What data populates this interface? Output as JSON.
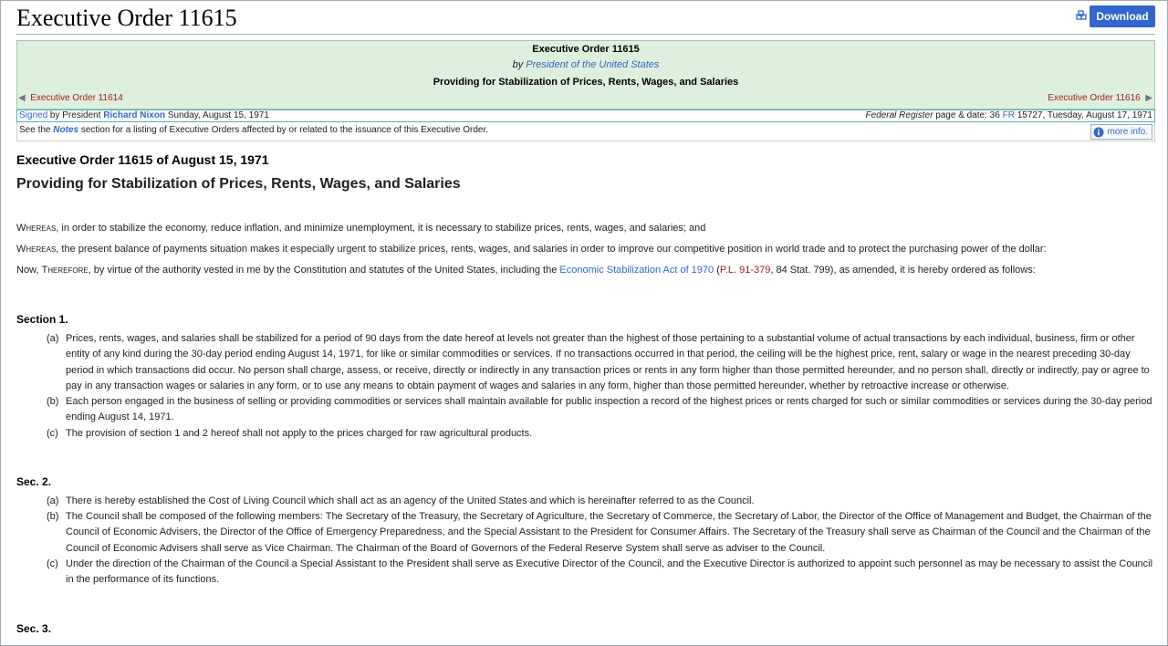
{
  "page": {
    "title": "Executive Order 11615",
    "download_label": "Download"
  },
  "header": {
    "title": "Executive Order 11615",
    "author_prefix": "by",
    "author": "President of the United States",
    "subtitle": "Providing for Stabilization of Prices, Rents, Wages, and Salaries",
    "prev": "Executive Order 11614",
    "next": "Executive Order 11616"
  },
  "signature": {
    "signed_link": "Signed",
    "by_text": "by President",
    "president": "Richard Nixon",
    "date": "Sunday, August 15, 1971",
    "fr_label": "Federal Register",
    "fr_text": "page & date: 36",
    "fr_abbr": "FR",
    "fr_rest": "15727, Tuesday, August 17, 1971"
  },
  "notes": {
    "prefix": "See the",
    "notes_link": "Notes",
    "suffix": "section for a listing of Executive Orders affected by or related to the issuance of this Executive Order.",
    "more_label": "more info."
  },
  "document": {
    "heading": "Executive Order 11615 of August 15, 1971",
    "subheading": "Providing for Stabilization of Prices, Rents, Wages, and Salaries",
    "whereas_word": "Whereas",
    "whereas1": ", in order to stabilize the economy, reduce inflation, and minimize unemployment, it is necessary to stabilize prices, rents, wages, and salaries; and",
    "whereas2": ", the present balance of payments situation makes it especially urgent to stabilize prices, rents, wages, and salaries in order to improve our competitive position in world trade and to protect the purchasing power of the dollar:",
    "now_a": "Now, ",
    "therefore_word": "Therefore",
    "now_b": ", by virtue of the authority vested in me by the Constitution and statutes of the United States, including the ",
    "act_link": "Economic Stabilization Act of 1970",
    "paren_open": " (",
    "pl_link": "P.L. 91-379",
    "now_c": ", 84 Stat. 799), as amended, it is hereby ordered as follows:",
    "sections": [
      {
        "label": "Section  1.",
        "items": [
          {
            "marker": "(a)",
            "text": "Prices, rents, wages, and salaries shall be stabilized for a period of 90 days from the date hereof at levels not greater than the highest of those pertaining to a substantial volume of actual transactions by each individual, business, firm or other entity of any kind during the 30-day period ending August 14, 1971, for like or similar commodities or services. If no transactions occurred in that period, the ceiling will be the highest price, rent, salary or wage in the nearest preceding 30-day period in which transactions did occur. No person shall charge, assess, or receive, directly or indirectly in any transaction prices or rents in any form higher than those permitted hereunder, and no person shall, directly or indirectly, pay or agree to pay in any transaction wages or salaries in any form, or to use any means to obtain payment of wages and salaries in any form, higher than those permitted hereunder, whether by retroactive increase or otherwise."
          },
          {
            "marker": "(b)",
            "text": "Each person engaged in the business of selling or providing commodities or services shall maintain available for public inspection a record of the highest prices or rents charged for such or similar commodities or services during the 30-day period ending August 14, 1971."
          },
          {
            "marker": "(c)",
            "text": "The provision of section 1 and 2 hereof shall not apply to the prices charged for raw agricultural products."
          }
        ]
      },
      {
        "label": "Sec.  2.",
        "items": [
          {
            "marker": "(a)",
            "text": "There is hereby established the Cost of Living Council which shall act as an agency of the United States and which is hereinafter referred to as the Council."
          },
          {
            "marker": "(b)",
            "text": "The Council shall be composed of the following members: The Secretary of the Treasury, the Secretary of Agriculture, the Secretary of Commerce, the Secretary of Labor, the Director of the Office of Management and Budget, the Chairman of the Council of Economic Advisers, the Director of the Office of Emergency Preparedness, and the Special Assistant to the President for Consumer Affairs. The Secretary of the Treasury shall serve as Chairman of the Council and the Chairman of the Council of Economic Advisers shall serve as Vice Chairman. The Chairman of the Board of Governors of the Federal Reserve System shall serve as adviser to the Council."
          },
          {
            "marker": "(c)",
            "text": "Under the direction of the Chairman of the Council a Special Assistant to the President shall serve as Executive Director of the Council, and the Executive Director is authorized to appoint such personnel as may be necessary to assist the Council in the performance of its functions."
          }
        ]
      },
      {
        "label": "Sec.  3.",
        "items": []
      }
    ]
  }
}
